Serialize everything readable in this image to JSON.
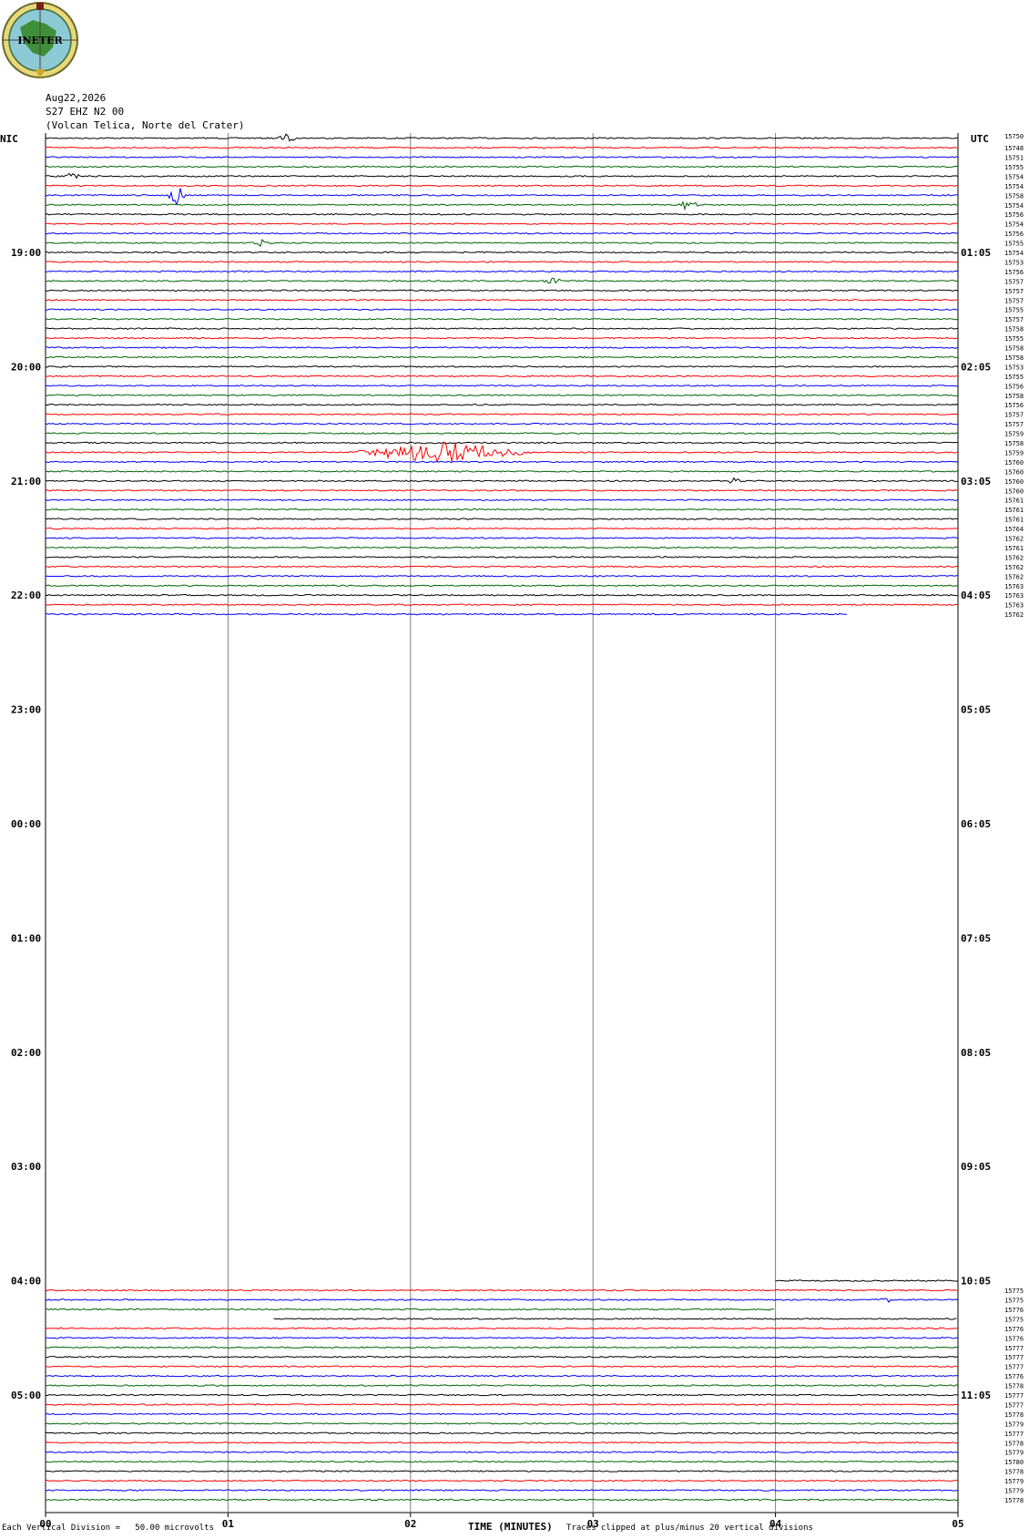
{
  "header": {
    "logo_text": "INETER",
    "date": "Aug22,2026",
    "station": "S27 EHZ N2 00",
    "location": "(Volcan Telica, Norte del Crater)",
    "left_timezone": "NIC",
    "right_timezone": "UTC"
  },
  "footer": {
    "scale_note": "Each Vertical Division =   50.00 microvolts",
    "xlabel": "TIME (MINUTES)",
    "clip_note": "Traces clipped at plus/minus 20 vertical divisions"
  },
  "colors": {
    "black": "#000000",
    "red": "#ff0000",
    "blue": "#0000ff",
    "green": "#006400",
    "grid": "#808080"
  },
  "chart_data": {
    "type": "line",
    "title": "S27 EHZ N2 00",
    "subtitle": "(Volcan Telica, Norte del Crater)",
    "xlabel": "TIME (MINUTES)",
    "xlim": [
      0,
      5
    ],
    "x_ticks": [
      "00",
      "01",
      "02",
      "03",
      "04",
      "05"
    ],
    "left_hour_labels": [
      "19:00",
      "20:00",
      "21:00",
      "22:00",
      "23:00",
      "00:00",
      "01:00",
      "02:00",
      "03:00",
      "04:00",
      "05:00"
    ],
    "right_hour_labels": [
      "01:05",
      "02:05",
      "03:05",
      "04:05",
      "05:05",
      "06:05",
      "07:05",
      "08:05",
      "09:05",
      "10:05",
      "11:05"
    ],
    "top_right_marker": "15750",
    "trace_color_cycle": [
      "black",
      "red",
      "blue",
      "green"
    ],
    "traces_before_first_hour": 12,
    "trace_slots_per_hour": 12,
    "block1_right_labels": [
      "15748",
      "15751",
      "15755",
      "15754",
      "15754",
      "15758",
      "15754",
      "15756",
      "15754",
      "15756",
      "15755",
      "15754",
      "15753",
      "15756",
      "15757",
      "15757",
      "15757",
      "15755",
      "15757",
      "15758",
      "15755",
      "15758",
      "15758",
      "15753",
      "15755",
      "15756",
      "15758",
      "15756",
      "15757",
      "15757",
      "15759",
      "15758",
      "15759",
      "15760",
      "15760",
      "15760",
      "15760",
      "15761",
      "15761",
      "15761",
      "15764",
      "15762",
      "15761",
      "15762",
      "15762",
      "15762",
      "15763",
      "15763",
      "15763",
      "15762"
    ],
    "block1_last_trace_end_min": 4.4,
    "block2_right_labels": [
      "15775",
      "15775",
      "15776",
      "15775",
      "15776",
      "15776",
      "15777",
      "15777",
      "15777",
      "15776",
      "15778",
      "15777",
      "15777",
      "15778",
      "15779",
      "15777",
      "15778",
      "15779",
      "15780",
      "15778",
      "15779",
      "15779",
      "15778"
    ],
    "block2_first_trace_start_min": 4.0,
    "block2_partial_traces": [
      {
        "slot": 3,
        "end_min": 4.0
      },
      {
        "slot": 4,
        "start_min": 1.25
      }
    ],
    "events": [
      {
        "trace": 0,
        "minute": 1.32,
        "amplitude": 5
      },
      {
        "trace": 4,
        "minute": 0.15,
        "amplitude": 4
      },
      {
        "trace": 6,
        "minute": 0.72,
        "amplitude": 12
      },
      {
        "trace": 7,
        "minute": 3.52,
        "amplitude": 7
      },
      {
        "trace": 11,
        "minute": 1.18,
        "amplitude": 4
      },
      {
        "trace": 15,
        "minute": 2.78,
        "amplitude": 4
      },
      {
        "trace": 33,
        "minute": 2.18,
        "amplitude": 12,
        "duration": 0.55
      },
      {
        "trace": 36,
        "minute": 3.78,
        "amplitude": 4
      },
      {
        "trace": 62,
        "minute": 4.6,
        "amplitude": 3
      }
    ],
    "scale": "Each Vertical Division = 50.00 microvolts",
    "clipping": "Traces clipped at plus/minus 20 vertical divisions"
  }
}
